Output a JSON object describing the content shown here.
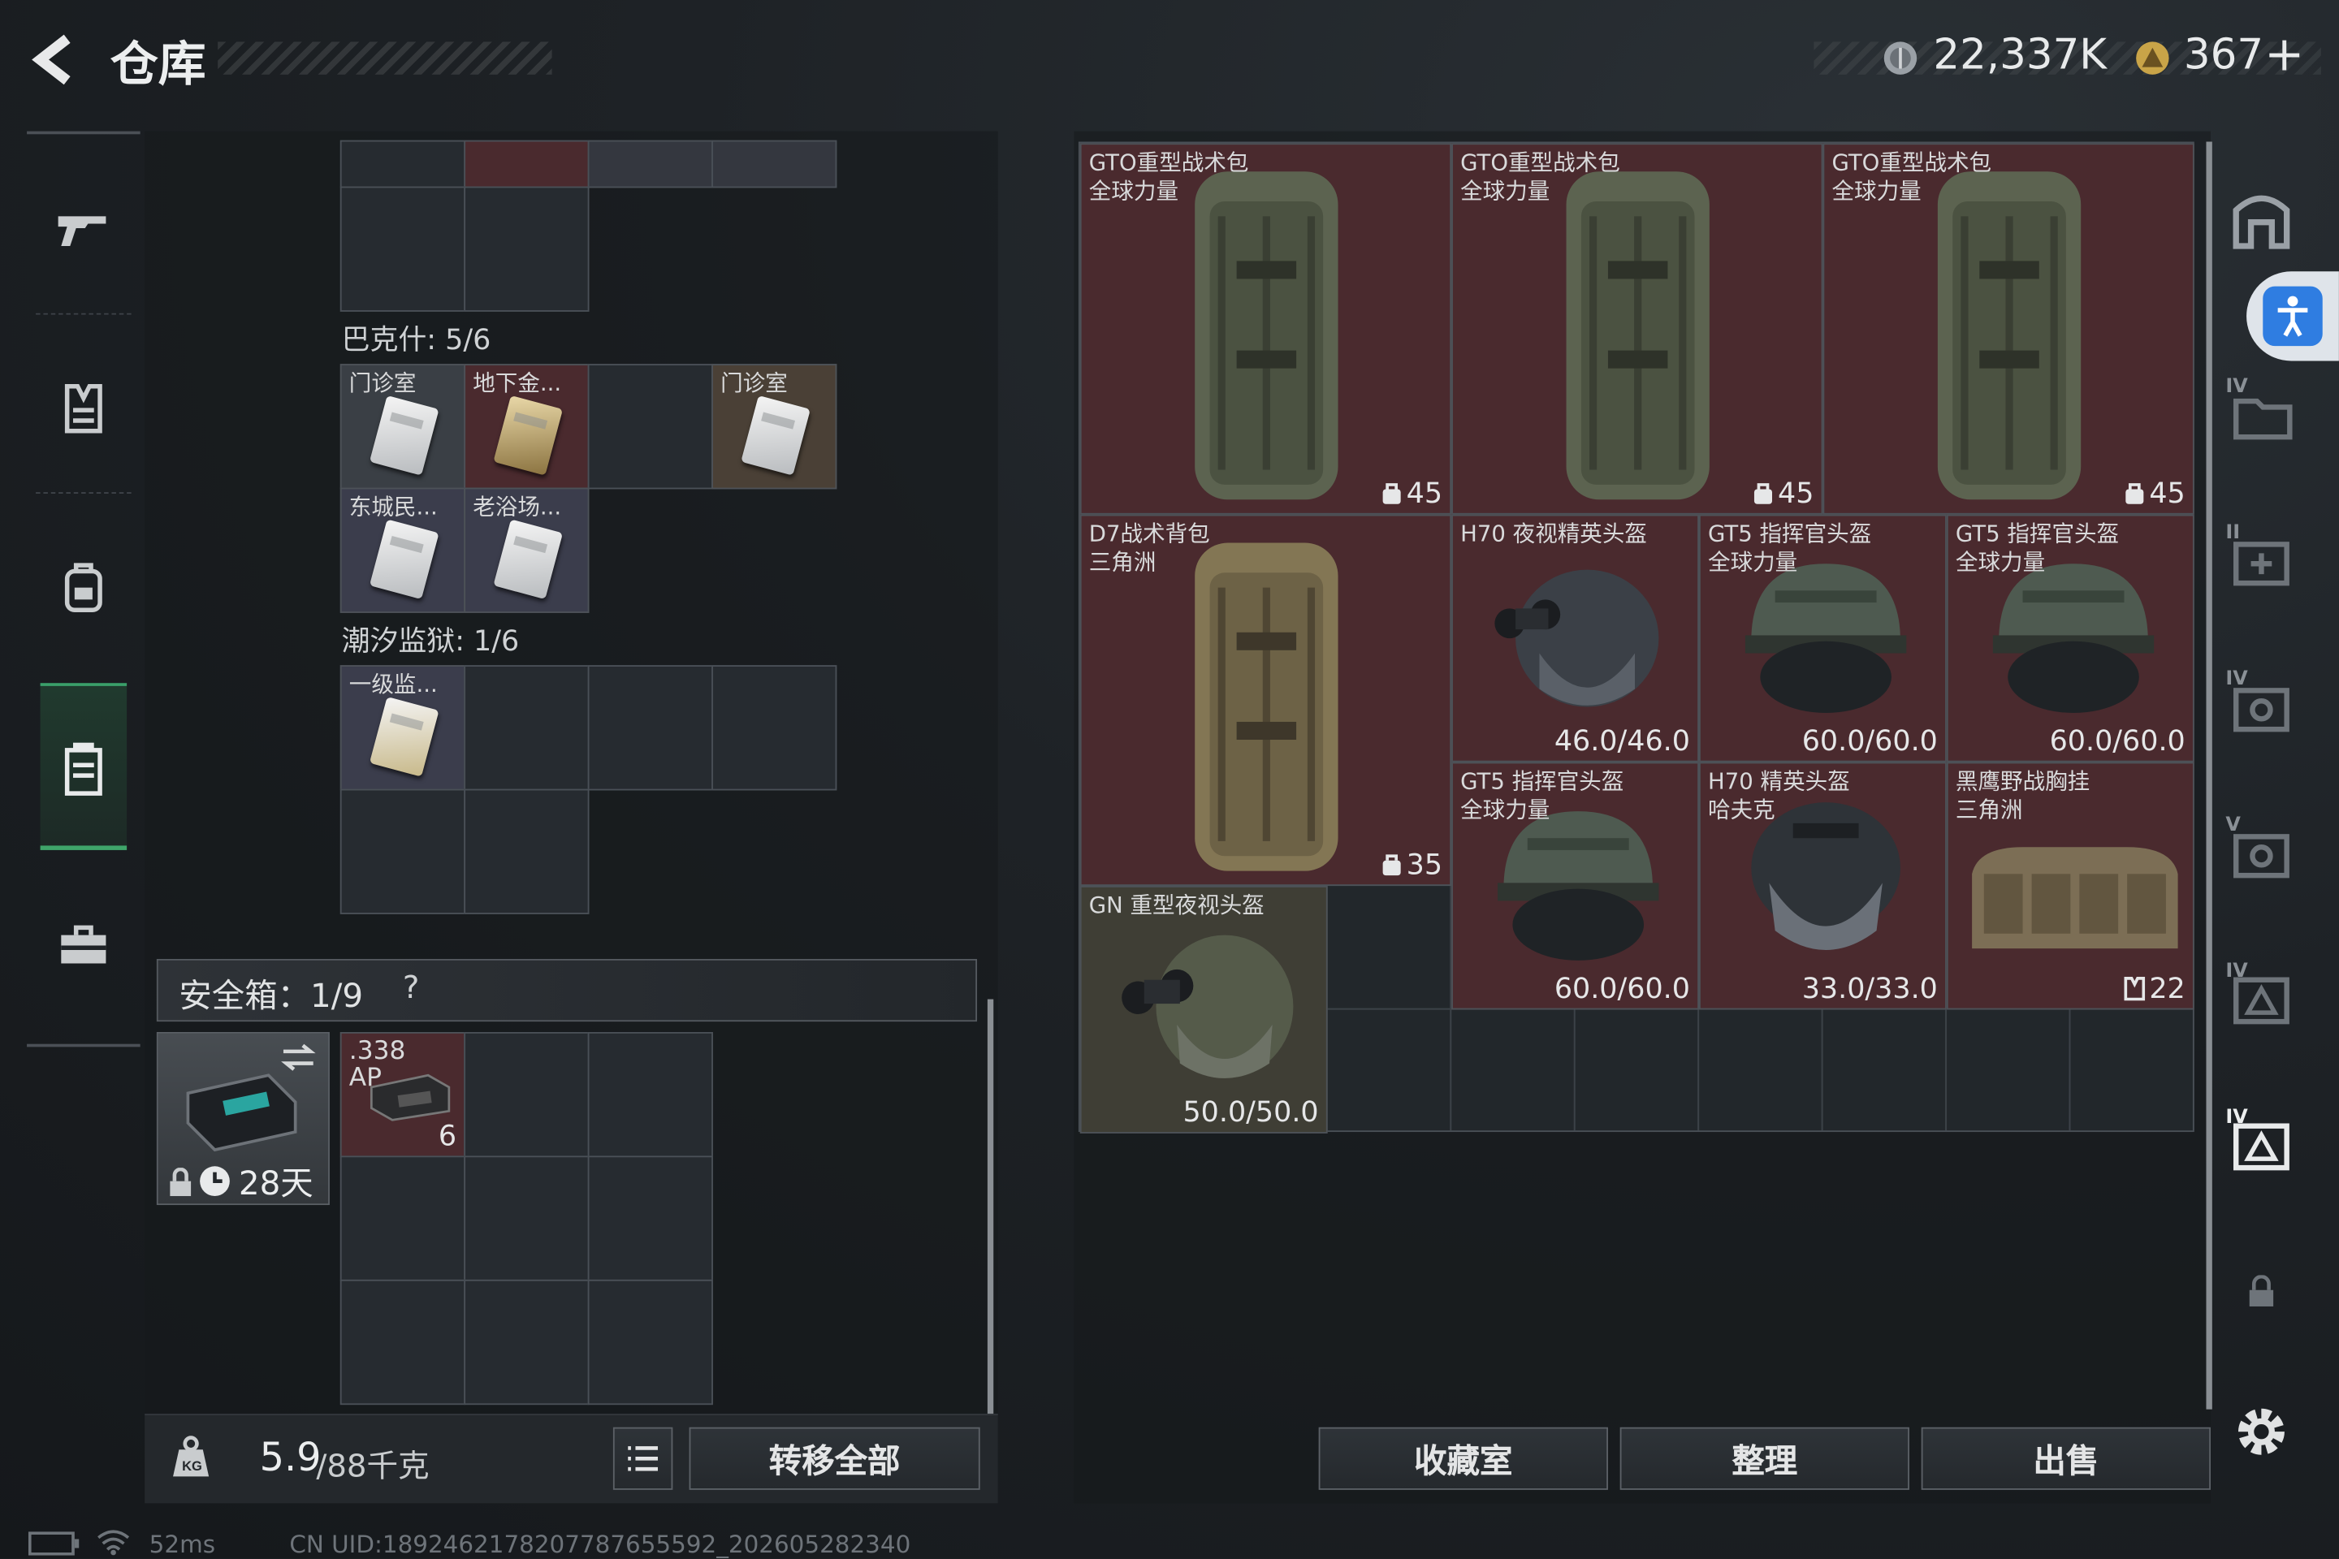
{
  "header": {
    "title": "仓库",
    "currency_1": "22,337K",
    "currency_2": "367",
    "currency_plus": "+"
  },
  "sidebar": {
    "items": [
      {
        "name": "weapon"
      },
      {
        "name": "armor"
      },
      {
        "name": "backpack"
      },
      {
        "name": "container",
        "active": true
      },
      {
        "name": "briefcase"
      }
    ]
  },
  "left_panel": {
    "group_1": {
      "label": "巴克什: 5/6",
      "items": [
        {
          "name": "门诊室"
        },
        {
          "name": "地下金..."
        },
        {
          "name": "门诊室"
        },
        {
          "name": "东城民..."
        },
        {
          "name": "老浴场..."
        }
      ]
    },
    "group_2": {
      "label": "潮汐监狱: 1/6",
      "items": [
        {
          "name": "一级监..."
        }
      ]
    },
    "safebox": {
      "label": "安全箱：1/9",
      "help": "?",
      "timer": "28天",
      "ammo_name": ".338\nAP",
      "ammo_count": "6"
    },
    "footer": {
      "weight_value": "5.9",
      "weight_unit": "/88千克",
      "transfer_all": "转移全部"
    }
  },
  "stash": {
    "items": [
      {
        "name": "GTO重型战术包\n全球力量",
        "value": "45"
      },
      {
        "name": "GTO重型战术包\n全球力量",
        "value": "45"
      },
      {
        "name": "GTO重型战术包\n全球力量",
        "value": "45"
      },
      {
        "name": "D7战术背包\n三角洲",
        "value": "35"
      },
      {
        "name": "H70 夜视精英头盔",
        "value": "46.0/46.0"
      },
      {
        "name": "GT5 指挥官头盔\n全球力量",
        "value": "60.0/60.0"
      },
      {
        "name": "GT5 指挥官头盔\n全球力量",
        "value": "60.0/60.0"
      },
      {
        "name": "GT5 指挥官头盔\n全球力量",
        "value": "60.0/60.0"
      },
      {
        "name": "H70 精英头盔\n哈夫克",
        "value": "33.0/33.0"
      },
      {
        "name": "黑鹰野战胸挂\n三角洲",
        "value": "22"
      },
      {
        "name": "GN 重型夜视头盔",
        "value": "50.0/50.0"
      }
    ]
  },
  "actions": {
    "collection": "收藏室",
    "sort": "整理",
    "sell": "出售"
  },
  "right_rail": {
    "labels": [
      "IV",
      "II",
      "IV",
      "V",
      "IV",
      "IV"
    ]
  },
  "status": {
    "ping": "52ms",
    "uid": "CN UID:1892462178207787655592_202605282340"
  },
  "colors": {
    "accent_green": "#3fa56a",
    "rare_red": "#4a2a2e",
    "access_blue": "#2f7de1"
  }
}
